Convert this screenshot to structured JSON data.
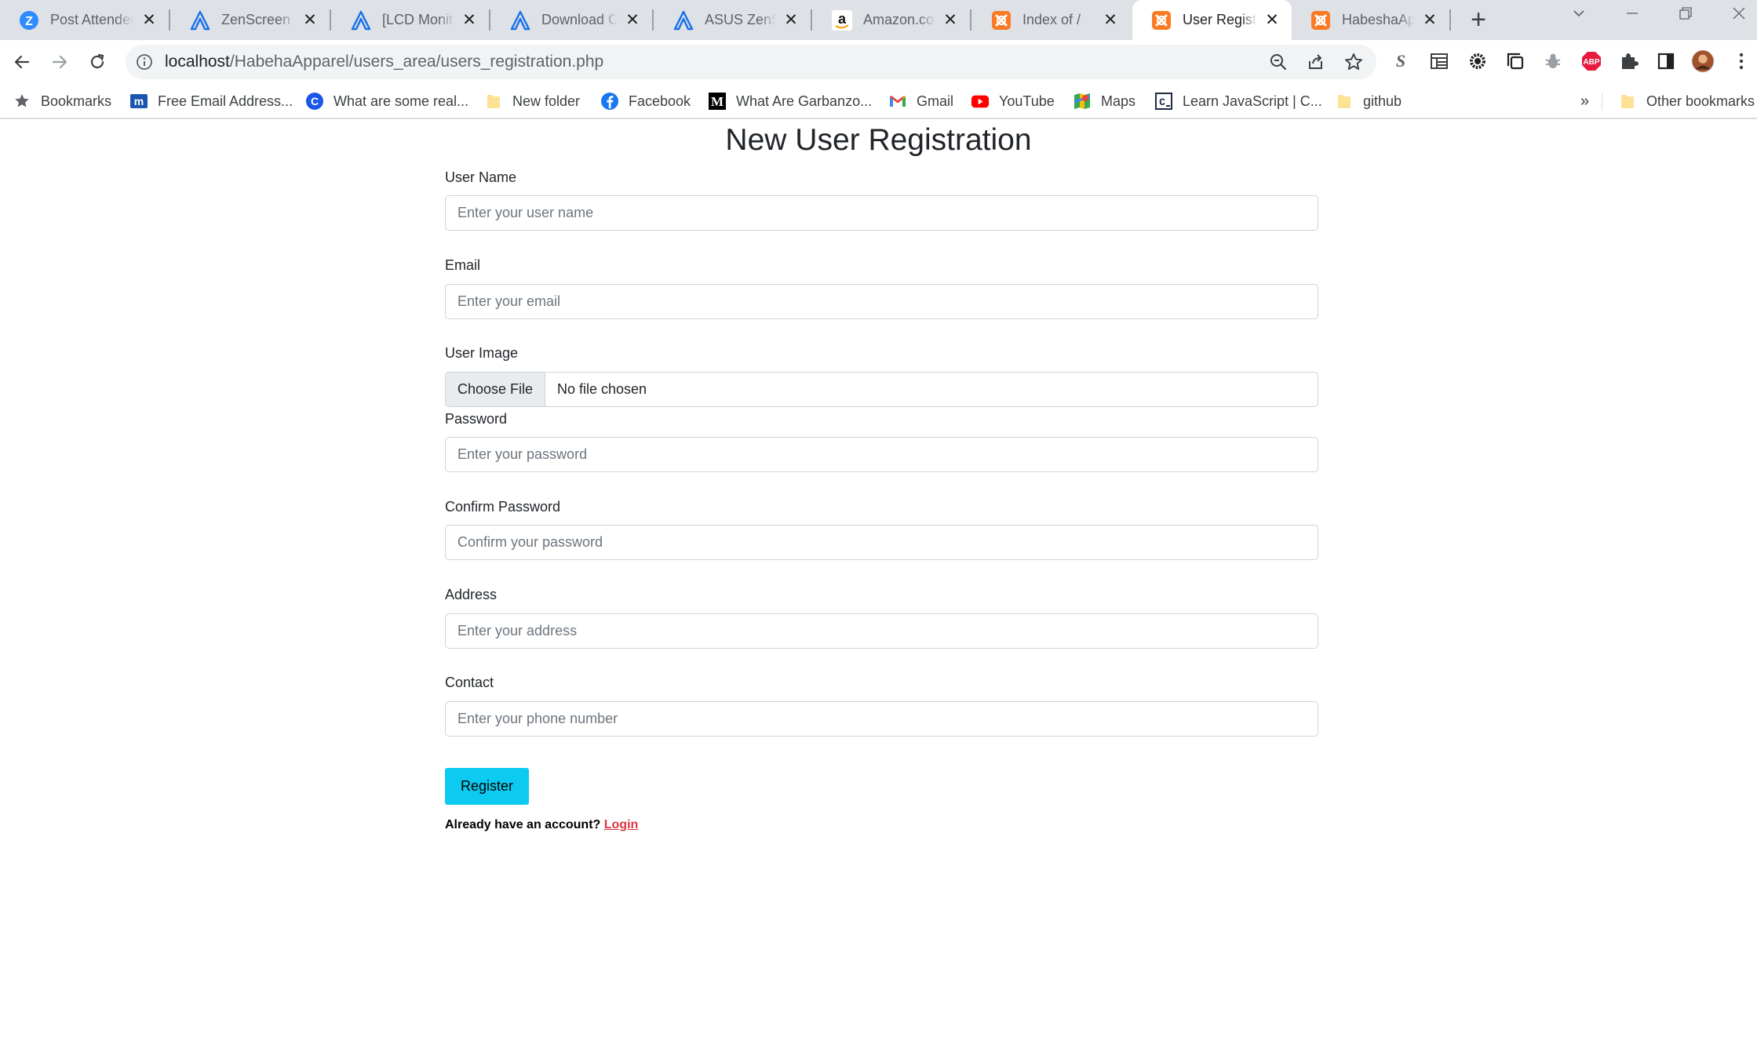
{
  "browser": {
    "tabs": [
      {
        "title": "Post Attendee",
        "icon": "zoom-icon",
        "active": false
      },
      {
        "title": "ZenScreen - A",
        "icon": "asus-icon",
        "active": false
      },
      {
        "title": "[LCD Monitor",
        "icon": "asus-icon",
        "active": false
      },
      {
        "title": "Download Ce",
        "icon": "asus-icon",
        "active": false
      },
      {
        "title": "ASUS ZenScr",
        "icon": "asus-icon",
        "active": false
      },
      {
        "title": "Amazon.com",
        "icon": "amazon-icon",
        "active": false
      },
      {
        "title": "Index of /",
        "icon": "xampp-icon",
        "active": false
      },
      {
        "title": "User Registra",
        "icon": "xampp-icon",
        "active": true
      },
      {
        "title": "HabeshaAppa",
        "icon": "xampp-icon",
        "active": false
      }
    ],
    "address": {
      "host": "localhost",
      "path": "/HabehaApparel/users_area/users_registration.php"
    },
    "bookmarks": [
      {
        "label": "Bookmarks",
        "icon": "star-icon"
      },
      {
        "label": "Free Email Address...",
        "icon": "mailfence-icon"
      },
      {
        "label": "What are some real...",
        "icon": "c-icon"
      },
      {
        "label": "New folder",
        "icon": "folder-icon"
      },
      {
        "label": "Facebook",
        "icon": "facebook-icon"
      },
      {
        "label": "What Are Garbanzo...",
        "icon": "medium-icon"
      },
      {
        "label": "Gmail",
        "icon": "gmail-icon"
      },
      {
        "label": "YouTube",
        "icon": "youtube-icon"
      },
      {
        "label": "Maps",
        "icon": "maps-icon"
      },
      {
        "label": "Learn JavaScript | C...",
        "icon": "codecademy-icon"
      },
      {
        "label": "github",
        "icon": "folder-icon"
      }
    ],
    "bookmarks_overflow": "»",
    "other_bookmarks": "Other bookmarks"
  },
  "form": {
    "title": "New User Registration",
    "username": {
      "label": "User Name",
      "placeholder": "Enter your user name"
    },
    "email": {
      "label": "Email",
      "placeholder": "Enter your email"
    },
    "image": {
      "label": "User Image",
      "button": "Choose File",
      "status": "No file chosen"
    },
    "password": {
      "label": "Password",
      "placeholder": "Enter your password"
    },
    "confirm": {
      "label": "Confirm Password",
      "placeholder": "Confirm your password"
    },
    "address": {
      "label": "Address",
      "placeholder": "Enter your address"
    },
    "contact": {
      "label": "Contact",
      "placeholder": "Enter your phone number"
    },
    "submit": "Register",
    "login_prompt": "Already have an account?",
    "login_link": "Login"
  },
  "colors": {
    "register_button": "#0dcaf0",
    "login_link": "#dc3545",
    "tabstrip": "#dee1e6"
  }
}
